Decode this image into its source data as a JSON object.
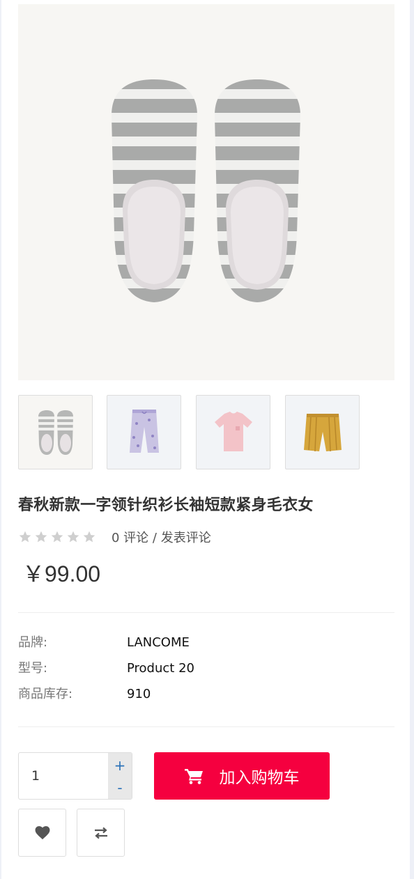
{
  "product": {
    "title": "春秋新款一字领针织衫长袖短款紧身毛衣女",
    "rating_stars": 0,
    "review_count_text": "0 评论",
    "separator": "/",
    "write_review_text": "发表评论",
    "price": "￥99.00"
  },
  "main_image": {
    "icon": "striped-slippers-image"
  },
  "thumbnails": [
    {
      "icon": "slippers-thumbnail"
    },
    {
      "icon": "printed-pajama-pants-thumbnail"
    },
    {
      "icon": "pink-tshirt-thumbnail"
    },
    {
      "icon": "yellow-striped-shorts-thumbnail"
    }
  ],
  "specs": [
    {
      "key": "品牌:",
      "value": "LANCOME"
    },
    {
      "key": "型号:",
      "value": "Product 20"
    },
    {
      "key": "商品库存:",
      "value": "910"
    }
  ],
  "purchase": {
    "quantity": "1",
    "plus": "+",
    "minus": "-",
    "add_to_cart_label": "加入购物车",
    "cart_icon": "shopping-cart-icon",
    "wishlist_icon": "heart-icon",
    "compare_icon": "compare-arrows-icon"
  },
  "colors": {
    "accent": "#f5003f",
    "stepper_text": "#2b72b8",
    "star_empty": "#cfcfcf"
  }
}
